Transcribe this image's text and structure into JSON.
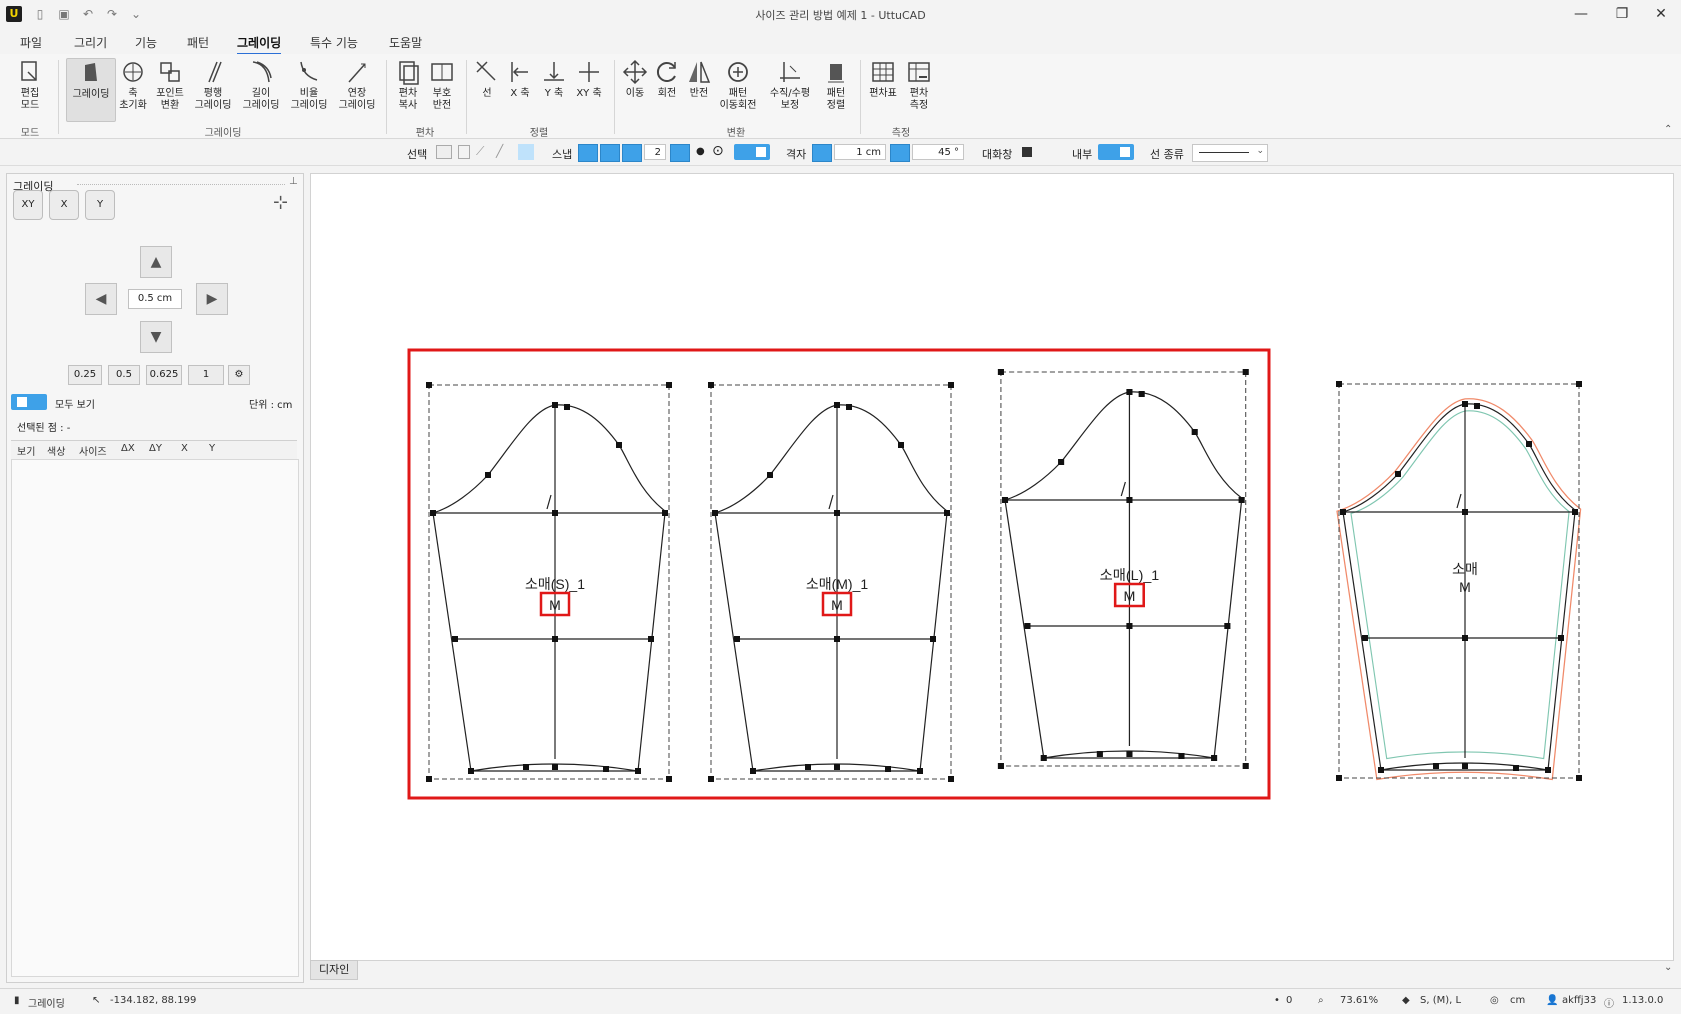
{
  "window": {
    "title": "사이즈 관리 방법 예제 1 - UttuCAD",
    "logo": "U"
  },
  "menu": {
    "tabs": [
      {
        "label": "파일"
      },
      {
        "label": "그리기"
      },
      {
        "label": "기능"
      },
      {
        "label": "패턴"
      },
      {
        "label": "그레이딩"
      },
      {
        "label": "특수 기능"
      },
      {
        "label": "도움말"
      }
    ],
    "active": "그레이딩"
  },
  "ribbon": {
    "buttons": {
      "edit_mode": "편집\n모드",
      "grading": "그레이딩",
      "axis_reset": "축\n초기화",
      "point_convert": "포인트\n변환",
      "parallel_grading": "평행\n그레이딩",
      "length_grading": "길이\n그레이딩",
      "ratio_grading": "비율\n그레이딩",
      "extend_grading": "연장\n그레이딩",
      "deviation_copy": "편차\n복사",
      "sign_flip": "부호\n반전",
      "align_line": "선",
      "align_x": "X 축",
      "align_y": "Y 축",
      "align_xy": "XY 축",
      "move": "이동",
      "rotate": "회전",
      "flip": "반전",
      "pattern_move_rotate": "패턴\n이동회전",
      "vh_correct": "수직/수평\n보정",
      "pattern_align": "패턴\n정렬",
      "deviation_table": "편차표",
      "deviation_measure": "편차\n측정"
    },
    "groups": {
      "mode": "모드",
      "grading": "그레이딩",
      "deviation": "편차",
      "align": "정렬",
      "transform": "변환",
      "measure": "측정"
    }
  },
  "toolbar": {
    "select_label": "선택",
    "snap_label": "스냅",
    "snap_value": "2",
    "grid_label": "격자",
    "grid_value": "1 cm",
    "angle_value": "45 °",
    "dialog_label": "대화창",
    "inner_label": "내부",
    "line_type_label": "선 종류"
  },
  "left_panel": {
    "title": "그레이딩",
    "step_value": "0.5 cm",
    "presets": [
      "0.25",
      "0.5",
      "0.625",
      "1"
    ],
    "show_all_label": "모두 보기",
    "unit_label": "단위 : cm",
    "selected_point_label": "선택된 점 : -",
    "columns": [
      "보기",
      "색상",
      "사이즈",
      "ΔX",
      "ΔY",
      "X",
      "Y"
    ],
    "xy_buttons": [
      "XY",
      "X",
      "Y"
    ]
  },
  "canvas": {
    "patterns": [
      {
        "name": "소매(S)_1",
        "size_mark": "M"
      },
      {
        "name": "소매(M)_1",
        "size_mark": "M"
      },
      {
        "name": "소매(L)_1",
        "size_mark": "M"
      },
      {
        "name": "소매",
        "size_mark": "M"
      }
    ],
    "highlight_color": "#e01818",
    "grading_colors": {
      "large": "#f08a6a",
      "small": "#7fc6b0",
      "base": "#222222"
    }
  },
  "design_tab": "디자인",
  "status": {
    "mode": "그레이딩",
    "coords": "-134.182, 88.199",
    "count": "0",
    "zoom": "73.61%",
    "sizes": "S, (M), L",
    "unit": "cm",
    "user": "akffj33",
    "version": "1.13.0.0"
  }
}
